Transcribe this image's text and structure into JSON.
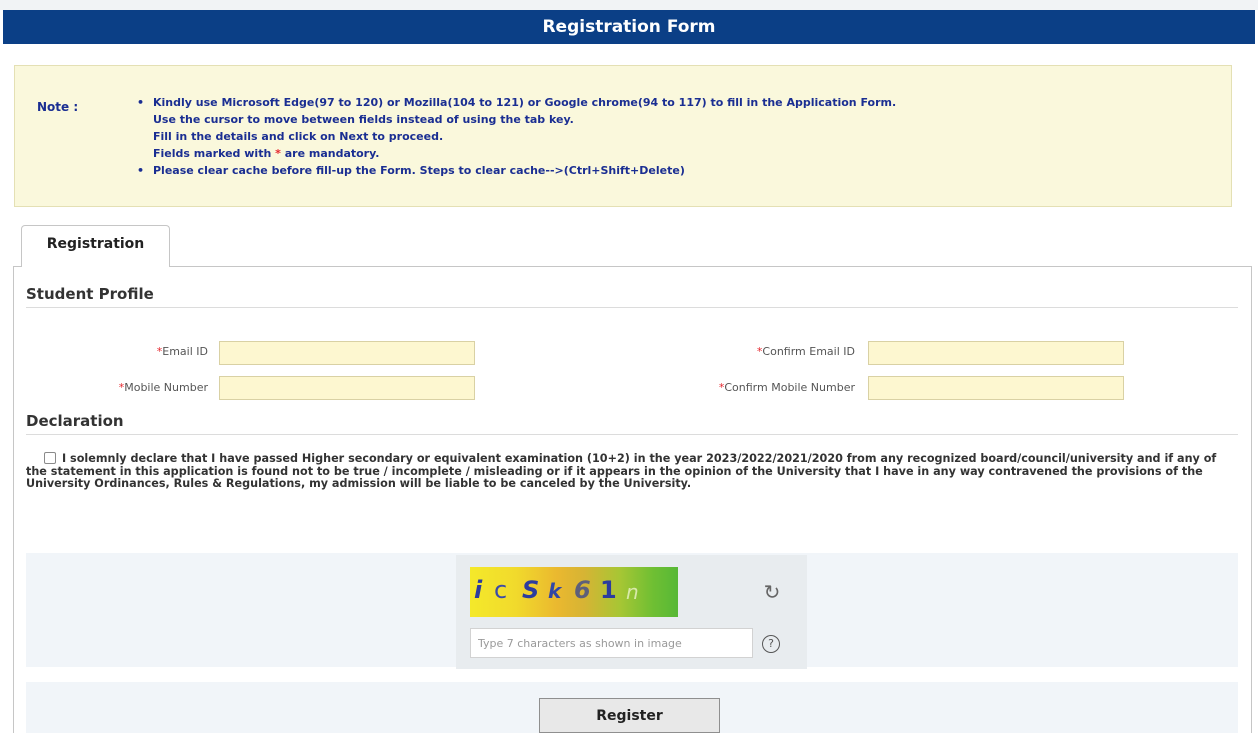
{
  "header": {
    "title": "Registration Form"
  },
  "note": {
    "label": "Note :",
    "lines": [
      {
        "bullet": "•",
        "text": "Kindly use Microsoft Edge(97 to 120) or Mozilla(104 to 121) or Google chrome(94 to 117) to fill in the Application Form."
      },
      {
        "bullet": "",
        "text": "Use the cursor to move between fields instead of using the tab key."
      },
      {
        "bullet": "",
        "text": "Fill in the details and click on Next to proceed."
      },
      {
        "bullet": "",
        "text_before": "Fields marked with ",
        "star": "*",
        "text_after": " are mandatory."
      },
      {
        "bullet": "•",
        "text": "Please clear cache before fill-up the Form. Steps to clear cache-->(Ctrl+Shift+Delete)"
      }
    ]
  },
  "tabs": [
    {
      "label": "Registration"
    }
  ],
  "student_profile": {
    "title": "Student Profile",
    "fields": {
      "email": {
        "star": "*",
        "label": "Email ID",
        "value": ""
      },
      "confirm_email": {
        "star": "*",
        "label": "Confirm Email ID",
        "value": ""
      },
      "mobile": {
        "star": "*",
        "label": "Mobile Number",
        "value": ""
      },
      "confirm_mobile": {
        "star": "*",
        "label": "Confirm Mobile Number",
        "value": ""
      }
    }
  },
  "declaration": {
    "title": "Declaration",
    "checked": false,
    "text": "I solemnly declare that I have passed Higher secondary or equivalent examination (10+2) in the year 2023/2022/2021/2020 from any recognized board/council/university and if any of the statement in this application is found not to be true / incomplete / misleading or if it appears in the opinion of the University that I have in any way contravened the provisions of the University Ordinances, Rules & Regulations, my admission will be liable to be canceled by the University."
  },
  "captcha": {
    "image_text": "ic Sk61n",
    "refresh_icon": "refresh-icon",
    "help_icon": "help-icon",
    "placeholder": "Type 7 characters as shown in image",
    "value": "",
    "colors": {
      "gradient_start": "#f4e92a",
      "gradient_end": "#57b836",
      "char_blue": "#2c3c9e",
      "char_gray": "#6f6f6f"
    }
  },
  "actions": {
    "register_label": "Register"
  },
  "colors": {
    "header_bg": "#0b3f86",
    "note_bg": "#faf8dc",
    "note_text": "#1a2e92",
    "required_star": "#e5262e",
    "field_bg": "#fdf7d0"
  }
}
